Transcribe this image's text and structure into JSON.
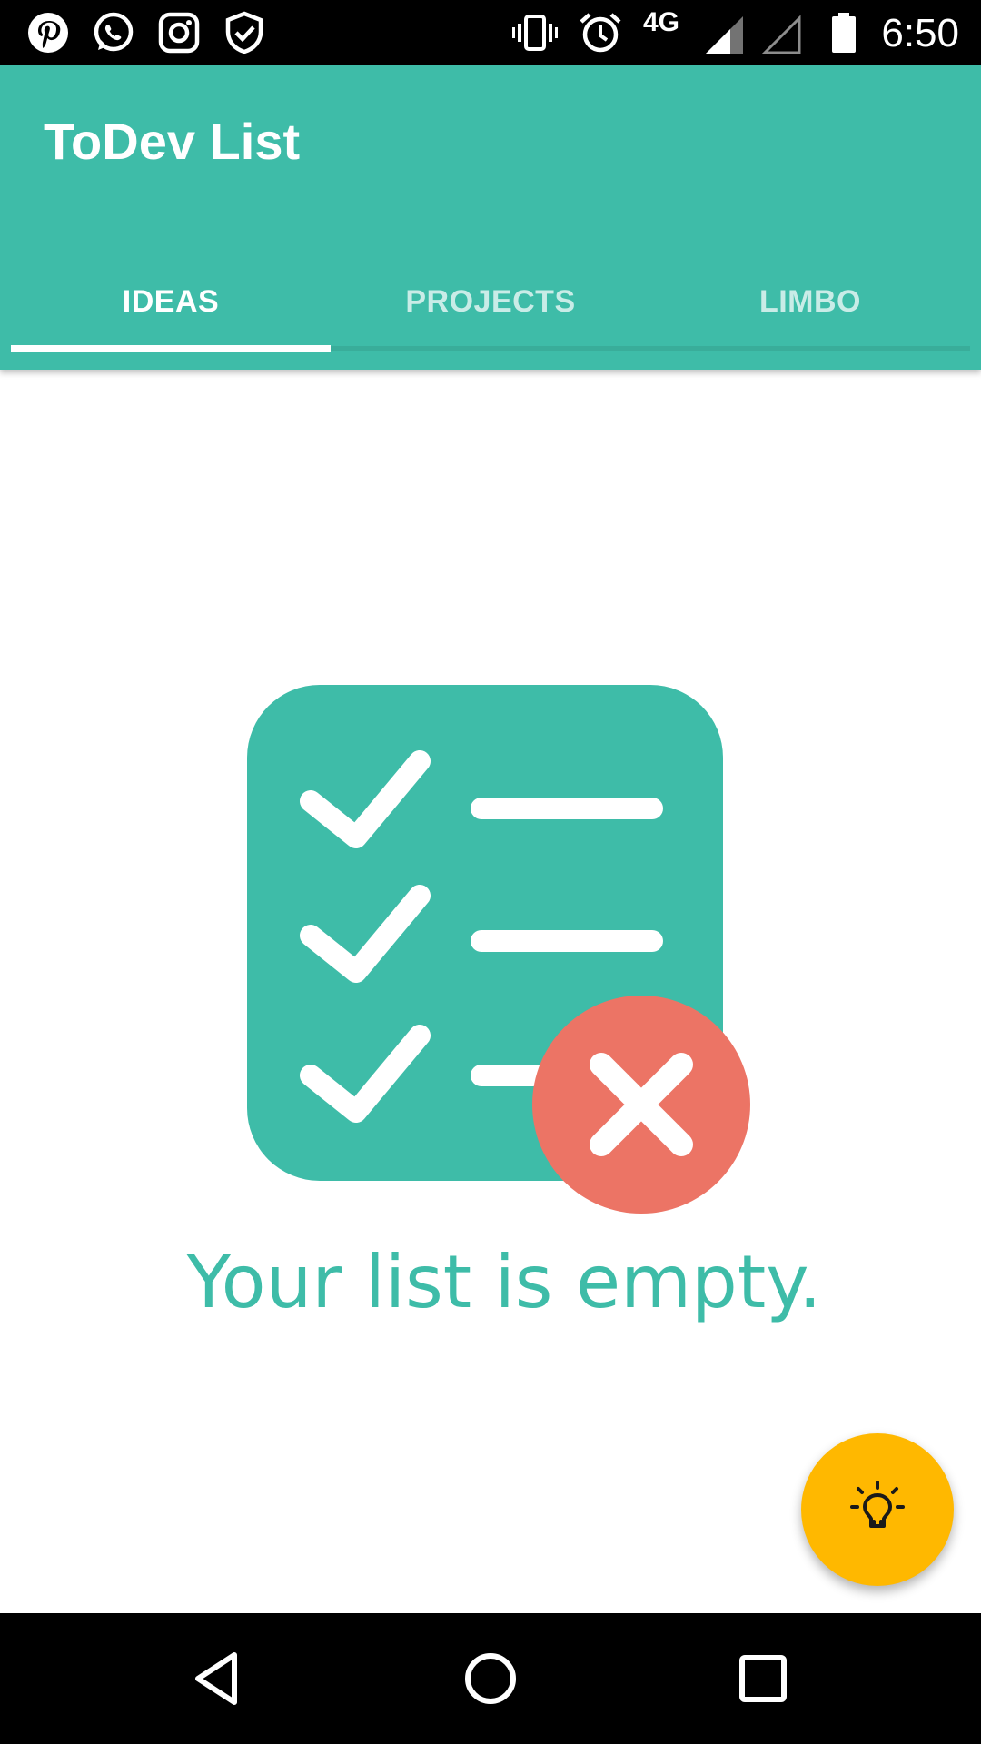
{
  "status_bar": {
    "time": "6:50",
    "network": "4G",
    "left_icons": [
      "pinterest-icon",
      "whatsapp-icon",
      "instagram-icon",
      "shield-check-icon"
    ],
    "right_icons": [
      "vibrate-icon",
      "alarm-icon",
      "signal-icon",
      "signal-empty-icon",
      "battery-icon"
    ]
  },
  "app_bar": {
    "title": "ToDev List",
    "color": "#3EBCA8"
  },
  "tabs": [
    {
      "label": "IDEAS",
      "active": true
    },
    {
      "label": "PROJECTS",
      "active": false
    },
    {
      "label": "LIMBO",
      "active": false
    }
  ],
  "empty_state": {
    "message": "Your list is empty.",
    "illustration": "checklist-empty-icon",
    "accent": "#3EBCA8",
    "badge_color": "#EC7465"
  },
  "fab": {
    "icon": "lightbulb-icon",
    "color": "#FFB800"
  },
  "nav_bar": {
    "icons": [
      "back-icon",
      "home-icon",
      "recents-icon"
    ]
  }
}
